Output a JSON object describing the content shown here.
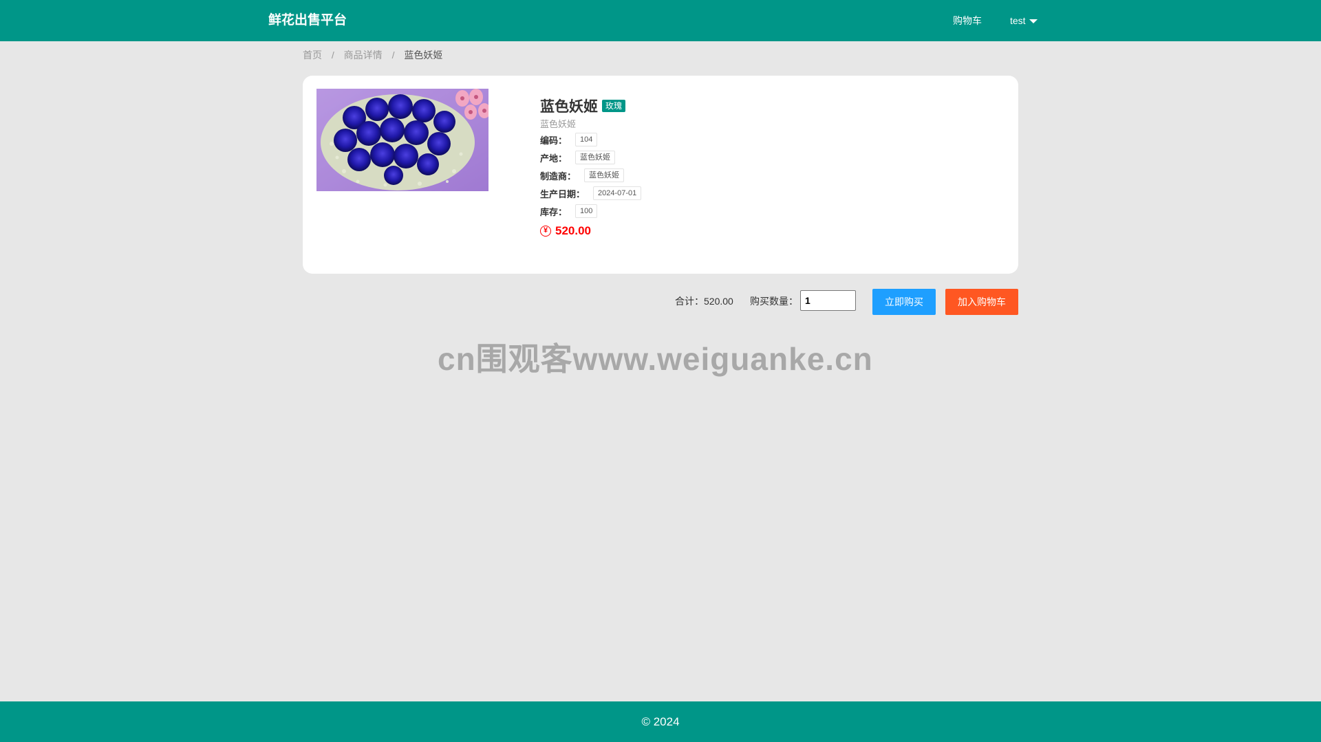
{
  "header": {
    "brand": "鲜花出售平台",
    "cart_link": "购物车",
    "user_menu": "test"
  },
  "breadcrumb": {
    "home": "首页",
    "detail": "商品详情",
    "current": "蓝色妖姬",
    "separator": "/"
  },
  "product": {
    "name": "蓝色妖姬",
    "category_tag": "玫瑰",
    "subtitle": "蓝色妖姬",
    "fields": [
      {
        "label": "编码：",
        "value": "104"
      },
      {
        "label": "产地：",
        "value": "蓝色妖姬"
      },
      {
        "label": "制造商：",
        "value": "蓝色妖姬"
      },
      {
        "label": "生产日期：",
        "value": "2024-07-01"
      },
      {
        "label": "库存：",
        "value": "100"
      }
    ],
    "currency_symbol": "¥",
    "price": "520.00"
  },
  "purchase": {
    "total_label": "合计：",
    "total_value": "520.00",
    "quantity_label": "购买数量：",
    "quantity_value": "1",
    "buy_now_label": "立即购买",
    "add_to_cart_label": "加入购物车"
  },
  "watermark": "cn围观客www.weiguanke.cn",
  "footer": {
    "copyright": "© 2024"
  },
  "colors": {
    "primary": "#009688",
    "buy_button": "#1e9fff",
    "cart_button": "#ff5722",
    "price": "#ff0000"
  }
}
